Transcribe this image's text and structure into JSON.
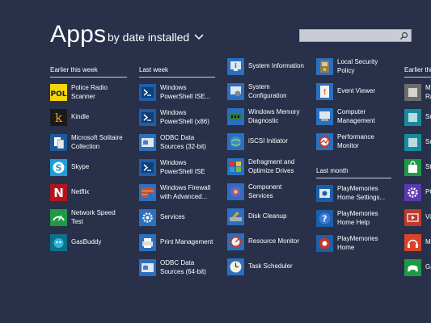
{
  "header": {
    "title": "Apps",
    "sort_label": "by date installed",
    "search": {
      "placeholder": "",
      "value": ""
    }
  },
  "groups": [
    {
      "label": "Earlier this week"
    },
    {
      "label": "Last week"
    },
    {
      "label": "Last month"
    },
    {
      "label": "Earlier this"
    }
  ],
  "apps": {
    "col1": [
      {
        "line1": "Police Radio",
        "line2": "Scanner",
        "icon": "police-radio-icon",
        "color": "#f5d60a"
      },
      {
        "line1": "Kindle",
        "line2": "",
        "icon": "kindle-icon",
        "color": "#1a1a1a"
      },
      {
        "line1": "Microsoft Solitaire",
        "line2": "Collection",
        "icon": "solitaire-icon",
        "color": "#1c5a9c"
      },
      {
        "line1": "Skype",
        "line2": "",
        "icon": "skype-icon",
        "color": "#1e9ed8"
      },
      {
        "line1": "Netflix",
        "line2": "",
        "icon": "netflix-icon",
        "color": "#b3141c"
      },
      {
        "line1": "Network Speed",
        "line2": "Test",
        "icon": "speed-test-icon",
        "color": "#1e9a46"
      },
      {
        "line1": "GasBuddy",
        "line2": "",
        "icon": "gasbuddy-icon",
        "color": "#0f6e8a"
      }
    ],
    "col2": [
      {
        "line1": "Windows",
        "line2": "PowerShell ISE...",
        "icon": "powershell-icon",
        "color": "#1f5fa8"
      },
      {
        "line1": "Windows",
        "line2": "PowerShell (x86)",
        "icon": "powershell-icon",
        "color": "#1f5fa8"
      },
      {
        "line1": "ODBC Data",
        "line2": "Sources (32-bit)",
        "icon": "odbc-icon",
        "color": "#2a6fc0"
      },
      {
        "line1": "Windows",
        "line2": "PowerShell ISE",
        "icon": "powershell-icon",
        "color": "#1f5fa8"
      },
      {
        "line1": "Windows Firewall",
        "line2": "with Advanced...",
        "icon": "firewall-icon",
        "color": "#2f6fbd"
      },
      {
        "line1": "Services",
        "line2": "",
        "icon": "services-icon",
        "color": "#2a6fc0"
      },
      {
        "line1": "Print Management",
        "line2": "",
        "icon": "print-management-icon",
        "color": "#2a6fc0"
      },
      {
        "line1": "ODBC Data",
        "line2": "Sources (64-bit)",
        "icon": "odbc-icon",
        "color": "#2a6fc0"
      }
    ],
    "col3": [
      {
        "line1": "System Information",
        "line2": "",
        "icon": "system-information-icon",
        "color": "#2a6fc0"
      },
      {
        "line1": "System",
        "line2": "Configuration",
        "icon": "system-configuration-icon",
        "color": "#2a6fc0"
      },
      {
        "line1": "Windows Memory",
        "line2": "Diagnostic",
        "icon": "memory-diagnostic-icon",
        "color": "#2a6fc0"
      },
      {
        "line1": "iSCSI Initiator",
        "line2": "",
        "icon": "iscsi-icon",
        "color": "#2a6fc0"
      },
      {
        "line1": "Defragment and",
        "line2": "Optimize Drives",
        "icon": "defragment-icon",
        "color": "#2a6fc0"
      },
      {
        "line1": "Component",
        "line2": "Services",
        "icon": "component-services-icon",
        "color": "#2a6fc0"
      },
      {
        "line1": "Disk Cleanup",
        "line2": "",
        "icon": "disk-cleanup-icon",
        "color": "#2a6fc0"
      },
      {
        "line1": "Resource Monitor",
        "line2": "",
        "icon": "resource-monitor-icon",
        "color": "#2a6fc0"
      },
      {
        "line1": "Task Scheduler",
        "line2": "",
        "icon": "task-scheduler-icon",
        "color": "#2a6fc0"
      }
    ],
    "col4": [
      {
        "line1": "Local Security",
        "line2": "Policy",
        "icon": "local-security-icon",
        "color": "#2a6fc0"
      },
      {
        "line1": "Event Viewer",
        "line2": "",
        "icon": "event-viewer-icon",
        "color": "#2a6fc0"
      },
      {
        "line1": "Computer",
        "line2": "Management",
        "icon": "computer-management-icon",
        "color": "#2a6fc0"
      },
      {
        "line1": "Performance",
        "line2": "Monitor",
        "icon": "performance-monitor-icon",
        "color": "#2a6fc0"
      }
    ],
    "col4b": [
      {
        "line1": "PlayMemories",
        "line2": "Home Settings...",
        "icon": "playmemories-settings-icon",
        "color": "#1a5fa8"
      },
      {
        "line1": "PlayMemories",
        "line2": "Home Help",
        "icon": "playmemories-help-icon",
        "color": "#1a5fa8"
      },
      {
        "line1": "PlayMemories",
        "line2": "Home",
        "icon": "playmemories-home-icon",
        "color": "#1a5fa8"
      }
    ],
    "col5": [
      {
        "line1": "M",
        "line2": "Ra",
        "icon": "app-icon",
        "color": "#6c6c6c"
      },
      {
        "line1": "Sr",
        "line2": "",
        "icon": "app-icon",
        "color": "#1a8a9a"
      },
      {
        "line1": "Sr",
        "line2": "",
        "icon": "app-icon",
        "color": "#1a8a9a"
      },
      {
        "line1": "St",
        "line2": "",
        "icon": "store-icon",
        "color": "#1e9a46"
      },
      {
        "line1": "PC",
        "line2": "",
        "icon": "gear-icon",
        "color": "#5a3ab0"
      },
      {
        "line1": "Vi",
        "line2": "",
        "icon": "video-icon",
        "color": "#c0392b"
      },
      {
        "line1": "M",
        "line2": "",
        "icon": "headphones-icon",
        "color": "#d9432b"
      },
      {
        "line1": "Ga",
        "line2": "",
        "icon": "xbox-games-icon",
        "color": "#1e9a46"
      }
    ]
  }
}
